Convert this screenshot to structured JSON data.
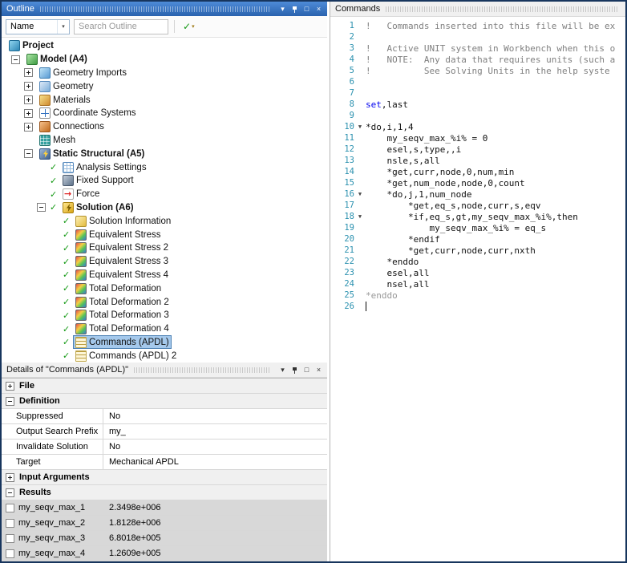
{
  "glyphs": {
    "chevron_down": "▼",
    "chevron_down_small": "▾",
    "maximize": "□",
    "close": "×",
    "check": "✓",
    "fold_marker": "▼"
  },
  "colors": {
    "tb_blue_top": "#4e8bd8",
    "tb_blue_bot": "#2a63ae",
    "selection_bg": "#a5c9ec",
    "selection_border": "#4e82b4",
    "check_green": "#149914",
    "keyword_blue": "#0000ee",
    "comment_gray": "#7f7f7f",
    "dim_gray": "#989898",
    "linenum_teal": "#2b91af",
    "result_gray": "#d8d8d8"
  },
  "outline_panel": {
    "title": "Outline",
    "toolbar": {
      "name_dropdown": "Name",
      "search_placeholder": "Search Outline"
    },
    "tree": [
      {
        "label": "Project",
        "level": 0,
        "icon": "project",
        "bold": true
      },
      {
        "label": "Model (A4)",
        "level": 1,
        "icon": "model",
        "expander": "minus",
        "bold": true
      },
      {
        "label": "Geometry Imports",
        "level": 2,
        "icon": "geometry-imports",
        "expander": "plus"
      },
      {
        "label": "Geometry",
        "level": 2,
        "icon": "geometry",
        "expander": "plus"
      },
      {
        "label": "Materials",
        "level": 2,
        "icon": "materials",
        "expander": "plus"
      },
      {
        "label": "Coordinate Systems",
        "level": 2,
        "icon": "coordinate-systems",
        "expander": "plus"
      },
      {
        "label": "Connections",
        "level": 2,
        "icon": "connections",
        "expander": "plus"
      },
      {
        "label": "Mesh",
        "level": 2,
        "icon": "mesh"
      },
      {
        "label": "Static Structural (A5)",
        "level": 2,
        "icon": "static-structural",
        "expander": "minus",
        "bold": true
      },
      {
        "label": "Analysis Settings",
        "level": 3,
        "icon": "analysis-settings",
        "check": true
      },
      {
        "label": "Fixed Support",
        "level": 3,
        "icon": "fixed-support",
        "check": true
      },
      {
        "label": "Force",
        "level": 3,
        "icon": "force",
        "check": true
      },
      {
        "label": "Solution (A6)",
        "level": 3,
        "icon": "solution",
        "expander": "minus",
        "bold": true,
        "check": true
      },
      {
        "label": "Solution Information",
        "level": 4,
        "icon": "solution-information",
        "check": true
      },
      {
        "label": "Equivalent Stress",
        "level": 4,
        "icon": "result",
        "check": true
      },
      {
        "label": "Equivalent Stress 2",
        "level": 4,
        "icon": "result",
        "check": true
      },
      {
        "label": "Equivalent Stress 3",
        "level": 4,
        "icon": "result",
        "check": true
      },
      {
        "label": "Equivalent Stress 4",
        "level": 4,
        "icon": "result",
        "check": true
      },
      {
        "label": "Total Deformation",
        "level": 4,
        "icon": "result",
        "check": true
      },
      {
        "label": "Total Deformation 2",
        "level": 4,
        "icon": "result",
        "check": true
      },
      {
        "label": "Total Deformation 3",
        "level": 4,
        "icon": "result",
        "check": true
      },
      {
        "label": "Total Deformation 4",
        "level": 4,
        "icon": "result",
        "check": true
      },
      {
        "label": "Commands (APDL)",
        "level": 4,
        "icon": "commands-apdl",
        "check": true,
        "selected": true
      },
      {
        "label": "Commands (APDL) 2",
        "level": 4,
        "icon": "commands-apdl",
        "check": true
      }
    ]
  },
  "commands_panel": {
    "title": "Commands",
    "code_lines": [
      {
        "n": 1,
        "s": "comment",
        "t": "!   Commands inserted into this file will be ex"
      },
      {
        "n": 2,
        "t": ""
      },
      {
        "n": 3,
        "s": "comment",
        "t": "!   Active UNIT system in Workbench when this o"
      },
      {
        "n": 4,
        "s": "comment",
        "t": "!   NOTE:  Any data that requires units (such a"
      },
      {
        "n": 5,
        "s": "comment",
        "t": "!          See Solving Units in the help syste"
      },
      {
        "n": 6,
        "t": ""
      },
      {
        "n": 7,
        "t": ""
      },
      {
        "n": 8,
        "seg": [
          {
            "t": "set",
            "c": "kw"
          },
          {
            "t": ",last",
            "c": "pl"
          }
        ]
      },
      {
        "n": 9,
        "t": ""
      },
      {
        "n": 10,
        "t": "*do,i,1,4",
        "fold": true
      },
      {
        "n": 11,
        "t": "    my_seqv_max_%i% = 0"
      },
      {
        "n": 12,
        "t": "    esel,s,type,,i"
      },
      {
        "n": 13,
        "t": "    nsle,s,all"
      },
      {
        "n": 14,
        "t": "    *get,curr,node,0,num,min"
      },
      {
        "n": 15,
        "t": "    *get,num_node,node,0,count"
      },
      {
        "n": 16,
        "t": "    *do,j,1,num_node",
        "fold": true
      },
      {
        "n": 17,
        "t": "        *get,eq_s,node,curr,s,eqv"
      },
      {
        "n": 18,
        "t": "        *if,eq_s,gt,my_seqv_max_%i%,then",
        "fold": true
      },
      {
        "n": 19,
        "t": "            my_seqv_max_%i% = eq_s"
      },
      {
        "n": 20,
        "t": "        *endif"
      },
      {
        "n": 21,
        "t": "        *get,curr,node,curr,nxth"
      },
      {
        "n": 22,
        "t": "    *enddo"
      },
      {
        "n": 23,
        "t": "    esel,all"
      },
      {
        "n": 24,
        "t": "    nsel,all"
      },
      {
        "n": 25,
        "s": "dim",
        "t": "*enddo"
      },
      {
        "n": 26,
        "t": "",
        "cursor": true
      }
    ]
  },
  "details_panel": {
    "title": "Details of \"Commands (APDL)\"",
    "rows": [
      {
        "type": "category",
        "label": "File",
        "expander": "plus"
      },
      {
        "type": "category",
        "label": "Definition",
        "expander": "minus"
      },
      {
        "type": "prop",
        "label": "Suppressed",
        "value": "No"
      },
      {
        "type": "prop",
        "label": "Output Search Prefix",
        "value": "my_"
      },
      {
        "type": "prop",
        "label": "Invalidate Solution",
        "value": "No"
      },
      {
        "type": "prop",
        "label": "Target",
        "value": "Mechanical APDL"
      },
      {
        "type": "category",
        "label": "Input Arguments",
        "expander": "plus"
      },
      {
        "type": "category",
        "label": "Results",
        "expander": "minus"
      },
      {
        "type": "result",
        "label": "my_seqv_max_1",
        "value": "2.3498e+006"
      },
      {
        "type": "result",
        "label": "my_seqv_max_2",
        "value": "1.8128e+006"
      },
      {
        "type": "result",
        "label": "my_seqv_max_3",
        "value": "6.8018e+005"
      },
      {
        "type": "result",
        "label": "my_seqv_max_4",
        "value": "1.2609e+005"
      }
    ]
  }
}
